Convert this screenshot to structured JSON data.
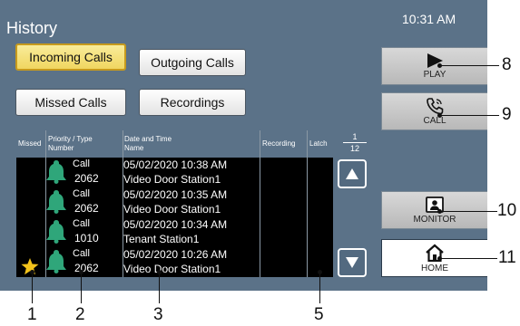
{
  "header": {
    "title": "History",
    "time": "10:31 AM"
  },
  "tabs": [
    {
      "label": "Incoming Calls",
      "active": true
    },
    {
      "label": "Outgoing Calls",
      "active": false
    },
    {
      "label": "Missed Calls",
      "active": false
    },
    {
      "label": "Recordings",
      "active": false
    }
  ],
  "columns": {
    "missed": "Missed",
    "priority_line1": "Priority / Type",
    "priority_line2": "Number",
    "datetime_line1": "Date and Time",
    "datetime_line2": "Name",
    "recording": "Recording",
    "latch": "Latch"
  },
  "rows": [
    {
      "type": "Call",
      "number": "2062",
      "datetime": "05/02/2020 10:38 AM",
      "name": "Video Door Station1",
      "missed": false
    },
    {
      "type": "Call",
      "number": "2062",
      "datetime": "05/02/2020 10:35 AM",
      "name": "Video Door Station1",
      "missed": false
    },
    {
      "type": "Call",
      "number": "1010",
      "datetime": "05/02/2020 10:34 AM",
      "name": "Tenant Station1",
      "missed": false
    },
    {
      "type": "Call",
      "number": "2062",
      "datetime": "05/02/2020 10:26 AM",
      "name": "Video Door Station1",
      "missed": true
    }
  ],
  "pager": {
    "current": "1",
    "total": "12"
  },
  "side_buttons": {
    "play": "PLAY",
    "call": "CALL",
    "monitor": "MONITOR",
    "home": "HOME"
  },
  "callouts": {
    "c1": "1",
    "c2": "2",
    "c3": "3",
    "c5": "5",
    "c8": "8",
    "c9": "9",
    "c10": "10",
    "c11": "11"
  },
  "colors": {
    "panel": "#5b7288",
    "active_tab": "#f3dc6e",
    "bell": "#2fa67a",
    "star": "#f2c21b"
  },
  "icons": [
    "play-icon",
    "phone-icon",
    "monitor-icon",
    "home-icon",
    "bell-icon",
    "star-icon",
    "up-arrow-icon",
    "down-arrow-icon"
  ]
}
